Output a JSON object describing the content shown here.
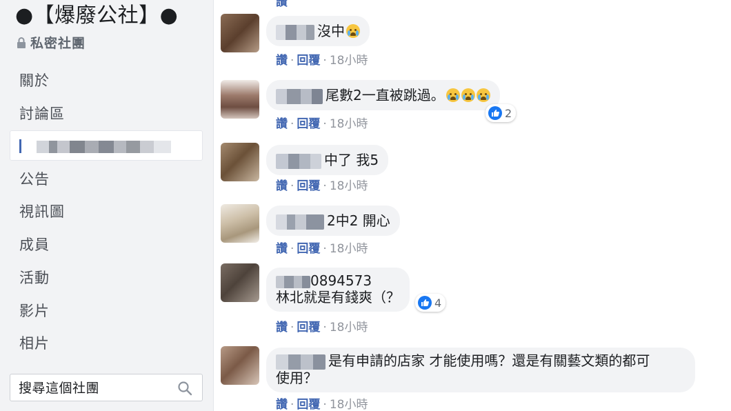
{
  "group": {
    "title": "●【爆廢公社】●",
    "privacy_label": "私密社團"
  },
  "nav": {
    "items": [
      "關於",
      "討論區",
      "公告",
      "視訊圖",
      "成員",
      "活動",
      "影片",
      "相片"
    ]
  },
  "search": {
    "placeholder": "搜尋這個社團"
  },
  "comments": [
    {
      "text": "沒中",
      "emoji_count": 1,
      "actions": [
        "讚",
        "回覆"
      ],
      "time": "18小時"
    },
    {
      "text": "尾數2一直被跳過。",
      "emoji_count": 3,
      "actions": [
        "讚",
        "回覆"
      ],
      "time": "18小時",
      "reaction_count": "2"
    },
    {
      "text": "中了 我5",
      "emoji_count": 0,
      "actions": [
        "讚",
        "回覆"
      ],
      "time": "18小時"
    },
    {
      "text": "2中2 開心",
      "emoji_count": 0,
      "actions": [
        "讚",
        "回覆"
      ],
      "time": "18小時"
    },
    {
      "name_suffix": "0894573",
      "text": "林北就是有錢爽（？",
      "emoji_count": 0,
      "actions": [
        "讚",
        "回覆"
      ],
      "time": "18小時",
      "reaction_count": "4"
    },
    {
      "text": "是有申請的店家 才能使用嗎？還是有關藝文類的都可",
      "text_line2": "使用？",
      "emoji_count": 0,
      "actions": [
        "讚",
        "回覆"
      ],
      "time": "18小時"
    }
  ],
  "colors": {
    "sidebar_bg": "#f2f3f5",
    "bubble_bg": "#f2f3f5",
    "link": "#4267b2",
    "meta": "#90949c",
    "like_blue": "#1877f2"
  }
}
